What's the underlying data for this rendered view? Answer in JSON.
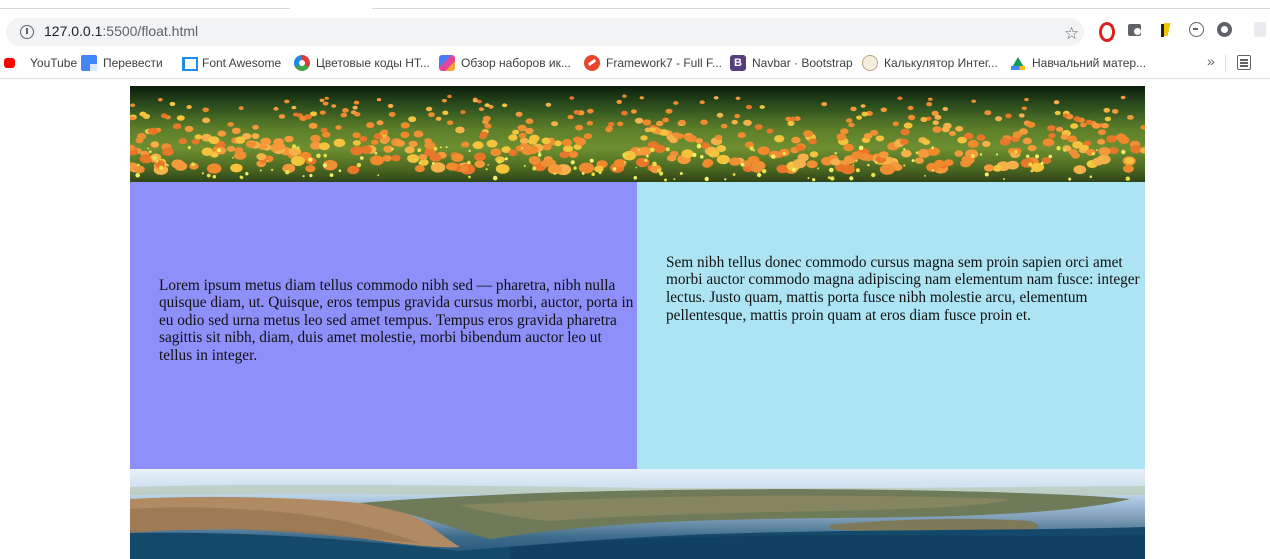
{
  "browser": {
    "url_host": "127.0.0.1",
    "url_path": ":5500/float.html",
    "bookmarks": [
      {
        "label": "YouTube",
        "icon": "youtube-icon"
      },
      {
        "label": "Перевести",
        "icon": "translate-icon"
      },
      {
        "label": "Font Awesome",
        "icon": "font-awesome-icon"
      },
      {
        "label": "Цветовые коды НТ...",
        "icon": "color-wheel-icon"
      },
      {
        "label": "Обзор наборов ик...",
        "icon": "icon-kit-icon"
      },
      {
        "label": "Framework7 - Full F...",
        "icon": "framework7-icon"
      },
      {
        "label": "Navbar · Bootstrap",
        "icon": "bootstrap-icon"
      },
      {
        "label": "Калькулятор Интег...",
        "icon": "calculator-icon"
      },
      {
        "label": "Навчальний матер...",
        "icon": "google-drive-icon"
      }
    ],
    "bootstrap_glyph": "B",
    "more_glyph": "»",
    "star_glyph": "☆"
  },
  "content": {
    "left_text": "Lorem ipsum metus diam tellus commodo nibh sed — pharetra, nibh nulla quisque diam, ut. Quisque, eros tempus gravida cursus morbi, auctor, porta in eu odio sed urna metus leo sed amet tempus. Tempus eros gravida pharetra sagittis sit nibh, diam, duis amet molestie, morbi bibendum auctor leo ut tellus in integer.",
    "right_text": "Sem nibh tellus donec commodo cursus magna sem proin sapien orci amet morbi auctor commodo magna adipiscing nam elementum nam fusce: integer lectus. Justo quam, mattis porta fusce nibh molestie arcu, elementum pellentesque, mattis proin quam at eros diam fusce proin et.",
    "colors": {
      "left_column": "#8f8ffa",
      "right_column": "#ade4f4"
    }
  }
}
